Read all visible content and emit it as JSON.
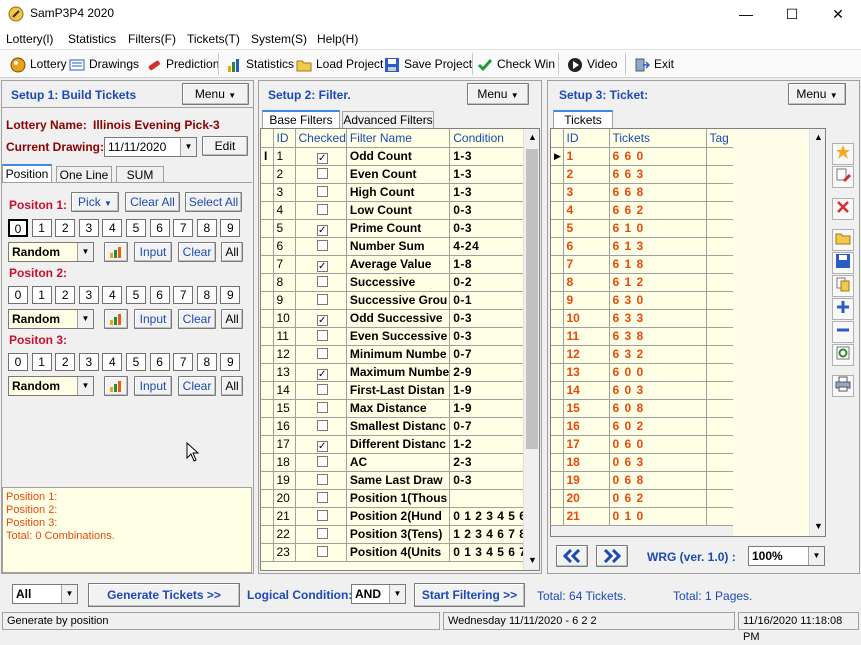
{
  "window": {
    "title": "SamP3P4 2020",
    "min": "—",
    "max": "☐",
    "close": "✕"
  },
  "menu": [
    "Lottery(l)",
    "Statistics",
    "Filters(F)",
    "Tickets(T)",
    "System(S)",
    "Help(H)"
  ],
  "toolbar": {
    "lottery": "Lottery",
    "drawings": "Drawings",
    "prediction": "Prediction",
    "statistics": "Statistics",
    "load_project": "Load Project",
    "save_project": "Save Project",
    "check_win": "Check Win",
    "video": "Video",
    "exit": "Exit"
  },
  "setup1": {
    "title": "Setup 1: Build  Tickets",
    "menu_label": "Menu",
    "lottery_label": "Lottery  Name:",
    "lottery_name": "Illinois Evening Pick-3",
    "current_drawing_label": "Current Drawing:",
    "current_drawing": "11/11/2020",
    "edit_label": "Edit",
    "tabs": [
      "Position",
      "One Line",
      "SUM"
    ],
    "pick_label": "Pick",
    "clear_all_label": "Clear All",
    "select_all_label": "Select All",
    "positions": [
      {
        "label": "Positon 1:",
        "mode": "Random"
      },
      {
        "label": "Positon 2:",
        "mode": "Random"
      },
      {
        "label": "Positon 3:",
        "mode": "Random"
      }
    ],
    "digits": [
      "0",
      "1",
      "2",
      "3",
      "4",
      "5",
      "6",
      "7",
      "8",
      "9"
    ],
    "input_label": "Input",
    "clear_label": "Clear",
    "all_label": "All",
    "summary": [
      "Position 1:",
      "Position 2:",
      "Position 3:",
      "Total: 0 Combinations."
    ]
  },
  "setup2": {
    "title": "Setup 2: Filter.",
    "menu_label": "Menu",
    "tabs": [
      "Base Filters",
      "Advanced Filters"
    ],
    "columns": [
      "ID",
      "Checked",
      "Filter Name",
      "Condition"
    ],
    "rows": [
      {
        "id": "1",
        "checked": true,
        "name": "Odd Count",
        "cond": "1-3"
      },
      {
        "id": "2",
        "checked": false,
        "name": "Even Count",
        "cond": "1-3"
      },
      {
        "id": "3",
        "checked": false,
        "name": "High Count",
        "cond": "1-3"
      },
      {
        "id": "4",
        "checked": false,
        "name": "Low Count",
        "cond": "0-3"
      },
      {
        "id": "5",
        "checked": true,
        "name": "Prime Count",
        "cond": "0-3"
      },
      {
        "id": "6",
        "checked": false,
        "name": "Number Sum",
        "cond": "4-24"
      },
      {
        "id": "7",
        "checked": true,
        "name": "Average Value",
        "cond": "1-8"
      },
      {
        "id": "8",
        "checked": false,
        "name": "Successive",
        "cond": "0-2"
      },
      {
        "id": "9",
        "checked": false,
        "name": "Successive Grou",
        "cond": "0-1"
      },
      {
        "id": "10",
        "checked": true,
        "name": "Odd Successive",
        "cond": "0-3"
      },
      {
        "id": "11",
        "checked": false,
        "name": "Even Successive",
        "cond": "0-3"
      },
      {
        "id": "12",
        "checked": false,
        "name": "Minimum Numbe",
        "cond": "0-7"
      },
      {
        "id": "13",
        "checked": true,
        "name": "Maximum Numbe",
        "cond": "2-9"
      },
      {
        "id": "14",
        "checked": false,
        "name": "First-Last Distan",
        "cond": "1-9"
      },
      {
        "id": "15",
        "checked": false,
        "name": "Max Distance",
        "cond": "1-9"
      },
      {
        "id": "16",
        "checked": false,
        "name": "Smallest Distanc",
        "cond": "0-7"
      },
      {
        "id": "17",
        "checked": true,
        "name": "Different Distanc",
        "cond": "1-2"
      },
      {
        "id": "18",
        "checked": false,
        "name": "AC",
        "cond": "2-3"
      },
      {
        "id": "19",
        "checked": false,
        "name": "Same Last Draw",
        "cond": "0-3"
      },
      {
        "id": "20",
        "checked": false,
        "name": "Position 1(Thous",
        "cond": ""
      },
      {
        "id": "21",
        "checked": false,
        "name": "Position 2(Hund",
        "cond": "0 1 2 3 4 5 6"
      },
      {
        "id": "22",
        "checked": false,
        "name": "Position 3(Tens)",
        "cond": "1 2 3 4 6 7 8"
      },
      {
        "id": "23",
        "checked": false,
        "name": "Position 4(Units",
        "cond": "0 1 3 4 5 6 7"
      }
    ]
  },
  "setup3": {
    "title": "Setup 3: Ticket:",
    "menu_label": "Menu",
    "tab": "Tickets",
    "columns": [
      "ID",
      "Tickets",
      "Tag"
    ],
    "rows": [
      {
        "id": "1",
        "ticket": "6 6 0"
      },
      {
        "id": "2",
        "ticket": "6 6 3"
      },
      {
        "id": "3",
        "ticket": "6 6 8"
      },
      {
        "id": "4",
        "ticket": "6 6 2"
      },
      {
        "id": "5",
        "ticket": "6 1 0"
      },
      {
        "id": "6",
        "ticket": "6 1 3"
      },
      {
        "id": "7",
        "ticket": "6 1 8"
      },
      {
        "id": "8",
        "ticket": "6 1 2"
      },
      {
        "id": "9",
        "ticket": "6 3 0"
      },
      {
        "id": "10",
        "ticket": "6 3 3"
      },
      {
        "id": "11",
        "ticket": "6 3 8"
      },
      {
        "id": "12",
        "ticket": "6 3 2"
      },
      {
        "id": "13",
        "ticket": "6 0 0"
      },
      {
        "id": "14",
        "ticket": "6 0 3"
      },
      {
        "id": "15",
        "ticket": "6 0 8"
      },
      {
        "id": "16",
        "ticket": "6 0 2"
      },
      {
        "id": "17",
        "ticket": "0 6 0"
      },
      {
        "id": "18",
        "ticket": "0 6 3"
      },
      {
        "id": "19",
        "ticket": "0 6 8"
      },
      {
        "id": "20",
        "ticket": "0 6 2"
      },
      {
        "id": "21",
        "ticket": "0 1 0"
      }
    ],
    "wrg_label": "WRG (ver. 1.0) :",
    "zoom": "100%"
  },
  "bottom": {
    "filter_mode": "All",
    "generate_label": "Generate Tickets >>",
    "logical_label": "Logical Condition:",
    "logical_value": "AND",
    "start_filter_label": "Start Filtering >>",
    "total_tickets": "Total: 64 Tickets.",
    "total_pages": "Total: 1 Pages."
  },
  "status": {
    "left": "Generate by position",
    "middle": "Wednesday 11/11/2020 - 6 2 2",
    "right": "11/16/2020 11:18:08 PM"
  },
  "colors": {
    "accent": "#1c49b5",
    "highlight": "#e8490f",
    "grid_bg": "#ffffe6"
  }
}
